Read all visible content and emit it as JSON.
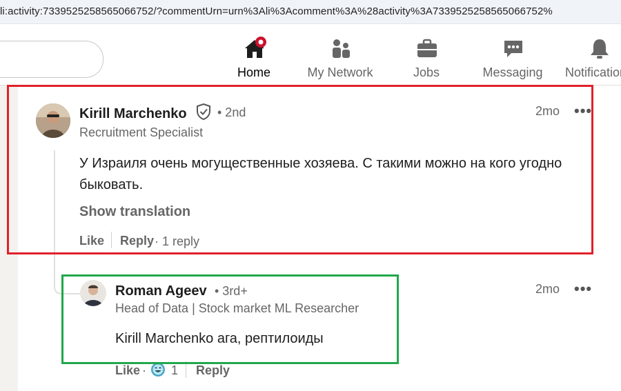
{
  "address_bar": {
    "url": "li:activity:7339525258565066752/?commentUrn=urn%3Ali%3Acomment%3A%28activity%3A7339525258565066752%"
  },
  "nav": {
    "items": [
      {
        "label": "Home",
        "icon": "home-icon",
        "active": true,
        "notification": true
      },
      {
        "label": "My Network",
        "icon": "network-icon"
      },
      {
        "label": "Jobs",
        "icon": "briefcase-icon"
      },
      {
        "label": "Messaging",
        "icon": "messaging-icon"
      },
      {
        "label": "Notifications",
        "icon": "bell-icon"
      }
    ]
  },
  "comment": {
    "author": "Kirill Marchenko",
    "degree": "• 2nd",
    "headline": "Recruitment Specialist",
    "time": "2mo",
    "more": "•••",
    "text": "У Израиля очень могущественные хозяева. С такими можно на кого угодно быковать.",
    "show_translation": "Show translation",
    "like": "Like",
    "reply": "Reply",
    "reply_count": "· 1 reply"
  },
  "reply": {
    "author": "Roman Ageev",
    "degree": "• 3rd+",
    "headline": "Head of Data | Stock market ML Researcher",
    "time": "2mo",
    "more": "•••",
    "text": "Kirill Marchenko ага, рептилоиды",
    "like": "Like",
    "dot": "·",
    "reaction_count": "1",
    "reply": "Reply"
  },
  "colors": {
    "highlight_red": "#e0202a",
    "highlight_green": "#1fa84a",
    "notification_badge": "#cb112d"
  }
}
